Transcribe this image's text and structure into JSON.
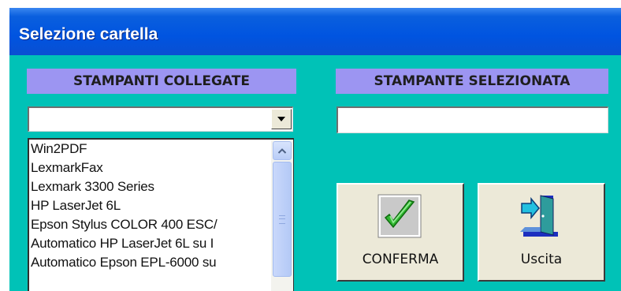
{
  "window": {
    "title": "Selezione cartella"
  },
  "left_panel": {
    "header": "STAMPANTI COLLEGATE",
    "combo_value": "",
    "printers": [
      "Win2PDF",
      "LexmarkFax",
      "Lexmark 3300 Series",
      "HP LaserJet 6L",
      "Epson Stylus COLOR 400 ESC/",
      "Automatico HP LaserJet 6L su I",
      "Automatico Epson EPL-6000 su"
    ]
  },
  "right_panel": {
    "header": "STAMPANTE SELEZIONATA",
    "selected_printer": ""
  },
  "buttons": {
    "confirm_label": "CONFERMA",
    "exit_label": "Uscita"
  },
  "icons": {
    "combo_arrow": "chevron-down-icon",
    "scroll_up": "chevron-up-icon",
    "confirm": "checkmark-icon",
    "exit": "exit-door-icon"
  },
  "colors": {
    "window_bg": "#00c2b7",
    "header_bg": "#9c95f2",
    "titlebar": "#0054e0",
    "checkmark": "#2fb52f"
  }
}
